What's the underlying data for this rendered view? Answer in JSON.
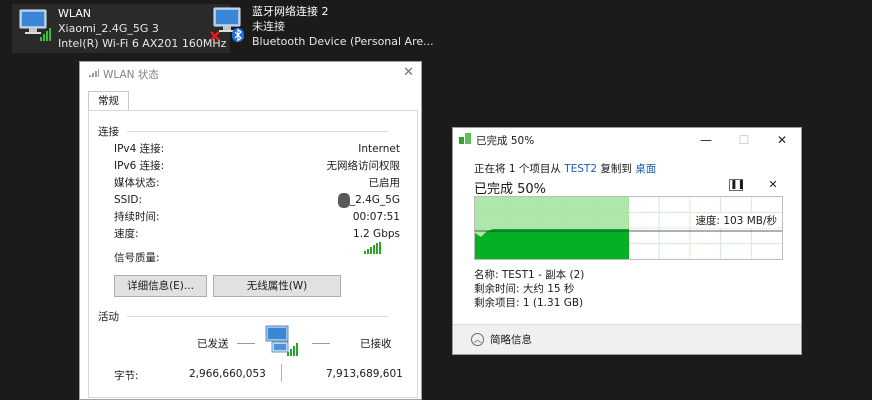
{
  "adapters": [
    {
      "name": "WLAN",
      "network": "Xiaomi_2.4G_5G 3",
      "device": "Intel(R) Wi-Fi 6 AX201 160MHz",
      "icon": "wifi-adapter-icon"
    },
    {
      "name": "蓝牙网络连接 2",
      "network": "未连接",
      "device": "Bluetooth Device (Personal Are...",
      "icon": "bluetooth-adapter-icon"
    }
  ],
  "wlan_dialog": {
    "title": "WLAN 状态",
    "tab": "常规",
    "connection_header": "连接",
    "rows": [
      {
        "key": "IPv4 连接:",
        "value": "Internet"
      },
      {
        "key": "IPv6 连接:",
        "value": "无网络访问权限"
      },
      {
        "key": "媒体状态:",
        "value": "已启用"
      },
      {
        "key": "SSID:",
        "value": "_2.4G_5G"
      },
      {
        "key": "持续时间:",
        "value": "00:07:51"
      },
      {
        "key": "速度:",
        "value": "1.2 Gbps"
      }
    ],
    "signal_label": "信号质量:",
    "details_button": "详细信息(E)...",
    "wireless_button": "无线属性(W)",
    "activity_header": "活动",
    "sent_label": "已发送",
    "received_label": "已接收",
    "bytes_label": "字节:",
    "bytes_sent": "2,966,660,053",
    "bytes_received": "7,913,689,601"
  },
  "copy_dialog": {
    "title": "已完成 50%",
    "progress_fraction": 0.5,
    "line_prefix": "正在将 1 个项目从",
    "source": "TEST2",
    "line_mid": "复制到",
    "dest": "桌面",
    "status": "已完成 50%",
    "speed": "速度: 103 MB/秒",
    "name": "名称: TEST1 - 副本 (2)",
    "time_left": "剩余时间: 大约 15 秒",
    "items_left": "剩余项目: 1 (1.31 GB)",
    "details_toggle": "简略信息",
    "colors": {
      "done_light": "#a6e3a1",
      "fill": "#06b025",
      "grid": "#d6ead6"
    }
  }
}
